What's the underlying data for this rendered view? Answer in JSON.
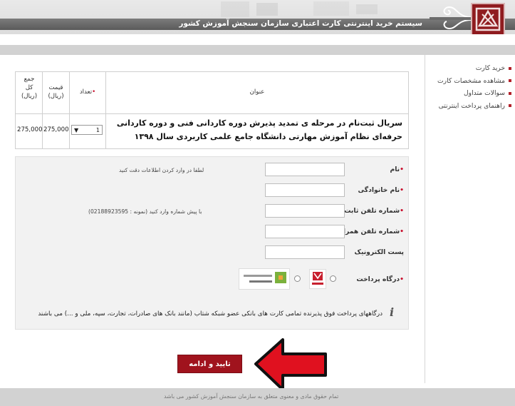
{
  "header": {
    "title": "سیستم خرید اینترنتی کارت اعتباری سازمان سنجش آموزش کشور"
  },
  "sidebar": {
    "items": [
      {
        "label": "خرید کارت"
      },
      {
        "label": "مشاهده مشخصات کارت"
      },
      {
        "label": "سوالات متداول"
      },
      {
        "label": "راهنمای پرداخت اینترنتی"
      }
    ]
  },
  "product": {
    "headers": {
      "title": "عنوان",
      "qty": "تعداد",
      "price_line1": "قیمت",
      "price_line2": "(ریال)",
      "total_line1": "جمع",
      "total_line2": "کل",
      "total_line3": "(ریال)"
    },
    "row": {
      "title": "سریال ثبت‌نام در مرحله ی تمدید پذیرش دوره کاردانی فنی و دوره کاردانی حرفه‌ای نظام آموزش مهارتی دانشگاه جامع علمی کاربردی سال ۱۳۹۸",
      "qty": "1",
      "price": "275,000",
      "total": "275,000"
    }
  },
  "form": {
    "name_label": "نام",
    "lastname_label": "نام خانوادگی",
    "phone_label": "شماره تلفن ثابت",
    "mobile_label": "شماره تلفن همراه",
    "email_label": "پست الکترونیک",
    "gateway_label": "درگاه پرداخت",
    "name_hint": "لطفا در وارد کردن اطلاعات دقت کنید",
    "phone_hint": "با پیش شماره وارد کنید (نمونه : 02188923595)",
    "name_value": "",
    "lastname_value": "",
    "phone_value": "",
    "mobile_value": "",
    "email_value": "",
    "info": "درگاههای پرداخت فوق پذیرنده تمامی کارت های بانکی عضو شبکه شتاب (مانند بانک های صادرات، تجارت، سپه، ملی و ...) می باشند"
  },
  "submit_label": "تایید و ادامه",
  "footer": {
    "text": "تمام حقوق مادی و معنوی متعلق به سازمان سنجش آموزش کشور می باشد"
  },
  "colors": {
    "accent": "#a0131d",
    "header_band": "#6b6b6b",
    "arrow": "#e0111f"
  }
}
